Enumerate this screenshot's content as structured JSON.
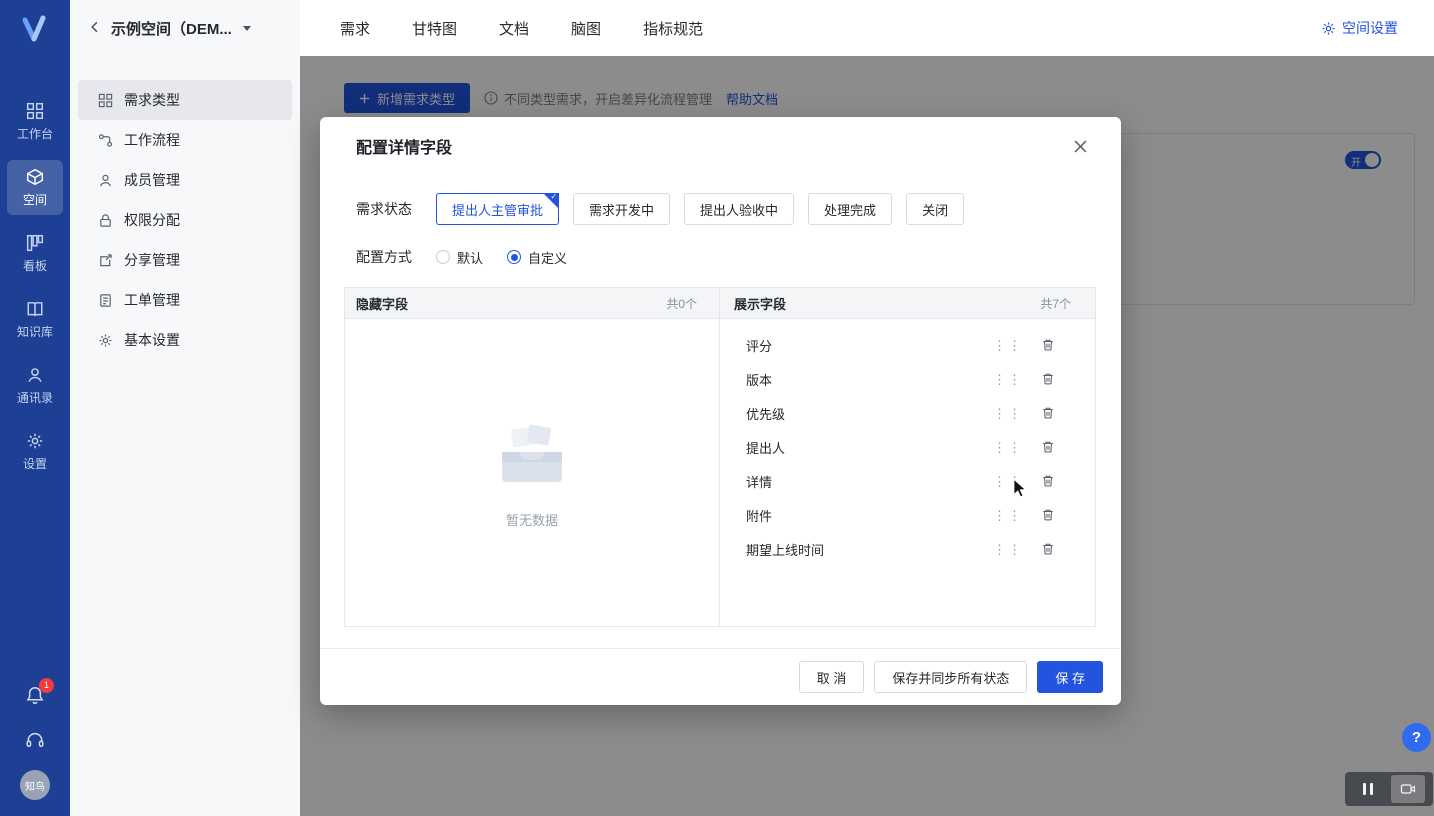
{
  "colors": {
    "primary": "#2254e0",
    "sidebar_bg": "#1d4094",
    "danger": "#f23c3c"
  },
  "left_sidebar": {
    "items": [
      {
        "label": "工作台",
        "icon": "workbench-grid",
        "active": false
      },
      {
        "label": "空间",
        "icon": "space-cube",
        "active": true
      },
      {
        "label": "看板",
        "icon": "kanban-board",
        "active": false
      },
      {
        "label": "知识库",
        "icon": "knowledge-book",
        "active": false
      },
      {
        "label": "通讯录",
        "icon": "contacts-person",
        "active": false
      },
      {
        "label": "设置",
        "icon": "settings-gear",
        "active": false
      }
    ],
    "notification_badge": "1",
    "avatar_text": "知鸟"
  },
  "space_sidebar": {
    "title": "示例空间（DEM...",
    "items": [
      {
        "label": "需求类型",
        "icon": "grid",
        "active": true
      },
      {
        "label": "工作流程",
        "icon": "workflow",
        "active": false
      },
      {
        "label": "成员管理",
        "icon": "member",
        "active": false
      },
      {
        "label": "权限分配",
        "icon": "lock",
        "active": false
      },
      {
        "label": "分享管理",
        "icon": "share",
        "active": false
      },
      {
        "label": "工单管理",
        "icon": "ticket",
        "active": false
      },
      {
        "label": "基本设置",
        "icon": "gear",
        "active": false
      }
    ]
  },
  "top_nav": {
    "tabs": [
      {
        "label": "需求"
      },
      {
        "label": "甘特图"
      },
      {
        "label": "文档"
      },
      {
        "label": "脑图"
      },
      {
        "label": "指标规范"
      }
    ],
    "settings_label": "空间设置"
  },
  "content": {
    "add_button_label": "新增需求类型",
    "info_text": "不同类型需求，开启差异化流程管理",
    "help_link_label": "帮助文档",
    "toggle_on_label": "开"
  },
  "modal": {
    "title": "配置详情字段",
    "status_row_label": "需求状态",
    "statuses": [
      {
        "label": "提出人主管审批",
        "selected": true
      },
      {
        "label": "需求开发中",
        "selected": false
      },
      {
        "label": "提出人验收中",
        "selected": false
      },
      {
        "label": "处理完成",
        "selected": false
      },
      {
        "label": "关闭",
        "selected": false
      }
    ],
    "config_row_label": "配置方式",
    "config_options": [
      {
        "label": "默认",
        "selected": false
      },
      {
        "label": "自定义",
        "selected": true
      }
    ],
    "hidden_panel": {
      "title": "隐藏字段",
      "count": "共0个",
      "empty_text": "暂无数据"
    },
    "display_panel": {
      "title": "展示字段",
      "count": "共7个",
      "fields": [
        {
          "label": "评分"
        },
        {
          "label": "版本"
        },
        {
          "label": "优先级"
        },
        {
          "label": "提出人"
        },
        {
          "label": "详情"
        },
        {
          "label": "附件"
        },
        {
          "label": "期望上线时间"
        }
      ]
    },
    "footer": {
      "cancel_label": "取 消",
      "save_sync_label": "保存并同步所有状态",
      "save_label": "保 存"
    }
  },
  "floating": {
    "help_label": "?"
  }
}
